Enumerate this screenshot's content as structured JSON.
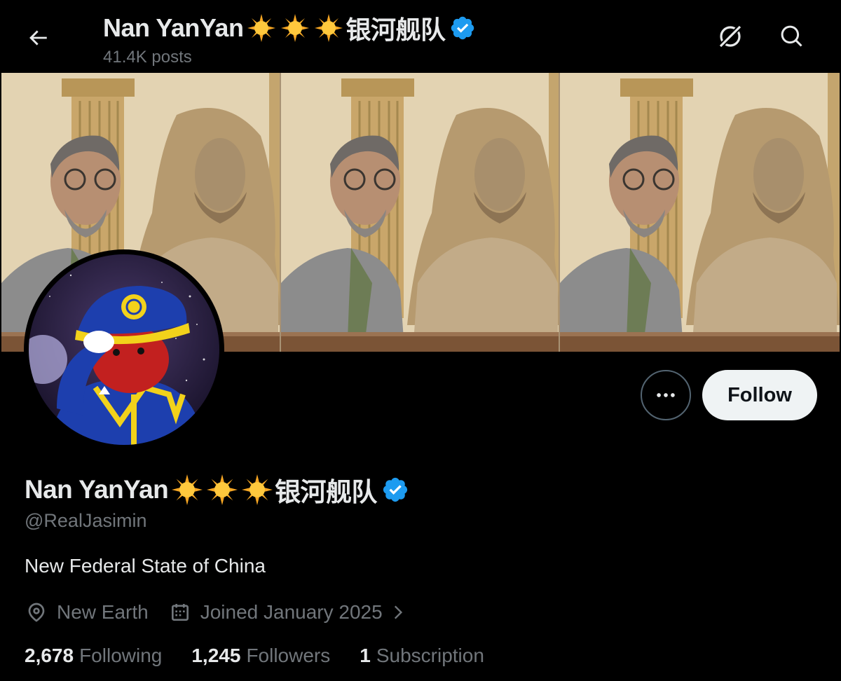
{
  "header": {
    "name": "Nan YanYan",
    "suffix": "银河舰队",
    "posts_count": "41.4K posts"
  },
  "profile": {
    "display_name": "Nan YanYan",
    "display_suffix": "银河舰队",
    "handle": "@RealJasimin",
    "bio": "New Federal State of China",
    "location": "New Earth",
    "joined": "Joined January 2025"
  },
  "actions": {
    "follow_label": "Follow"
  },
  "stats": {
    "following_count": "2,678",
    "following_label": "Following",
    "followers_count": "1,245",
    "followers_label": "Followers",
    "subscription_count": "1",
    "subscription_label": "Subscription"
  },
  "icons": {
    "back": "arrow-left-icon",
    "grok": "grok-icon",
    "search": "search-icon",
    "verified": "verified-badge-icon",
    "location": "location-pin-icon",
    "calendar": "calendar-icon",
    "more": "more-horizontal-icon",
    "sun_emoji": "sun-emoji-icon"
  },
  "colors": {
    "background": "#000000",
    "text_primary": "#e7e9ea",
    "text_secondary": "#71767b",
    "verified": "#1d9bf0",
    "follow_bg": "#eff3f4",
    "sun": "#f5b324"
  }
}
